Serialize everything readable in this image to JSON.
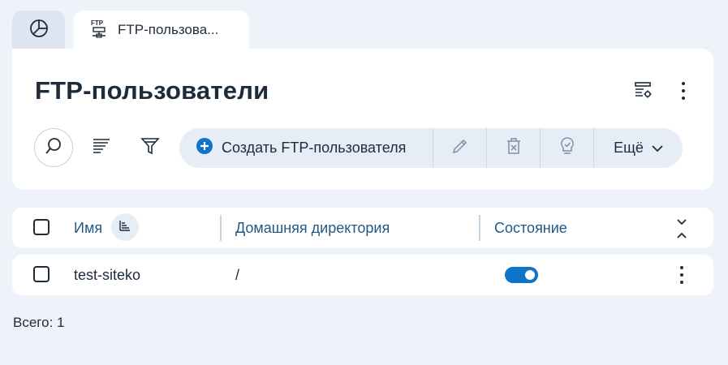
{
  "tabs": [
    {
      "icon": "pie-chart-icon"
    },
    {
      "icon": "ftp-icon",
      "label": "FTP-пользова...",
      "badge": "FTP"
    }
  ],
  "page": {
    "title": "FTP-пользователи"
  },
  "header_actions": {
    "settings_icon": "table-settings-icon",
    "menu_icon": "kebab-menu-icon"
  },
  "toolbar": {
    "search_icon": "search-icon",
    "sort_icon": "sort-lines-icon",
    "filter_icon": "filter-icon",
    "create_label": "Создать FTP-пользователя",
    "edit_icon": "pencil-icon",
    "delete_icon": "trash-icon",
    "hint_icon": "lightbulb-icon",
    "more_label": "Ещё"
  },
  "table": {
    "columns": [
      "Имя",
      "Домашняя директория",
      "Состояние"
    ],
    "rows": [
      {
        "name": "test-siteko",
        "home": "/",
        "enabled": true
      }
    ]
  },
  "footer": {
    "total": "Всего: 1"
  },
  "colors": {
    "accent": "#0e74c9",
    "background": "#eef2f9",
    "header_text": "#1f5a86"
  }
}
